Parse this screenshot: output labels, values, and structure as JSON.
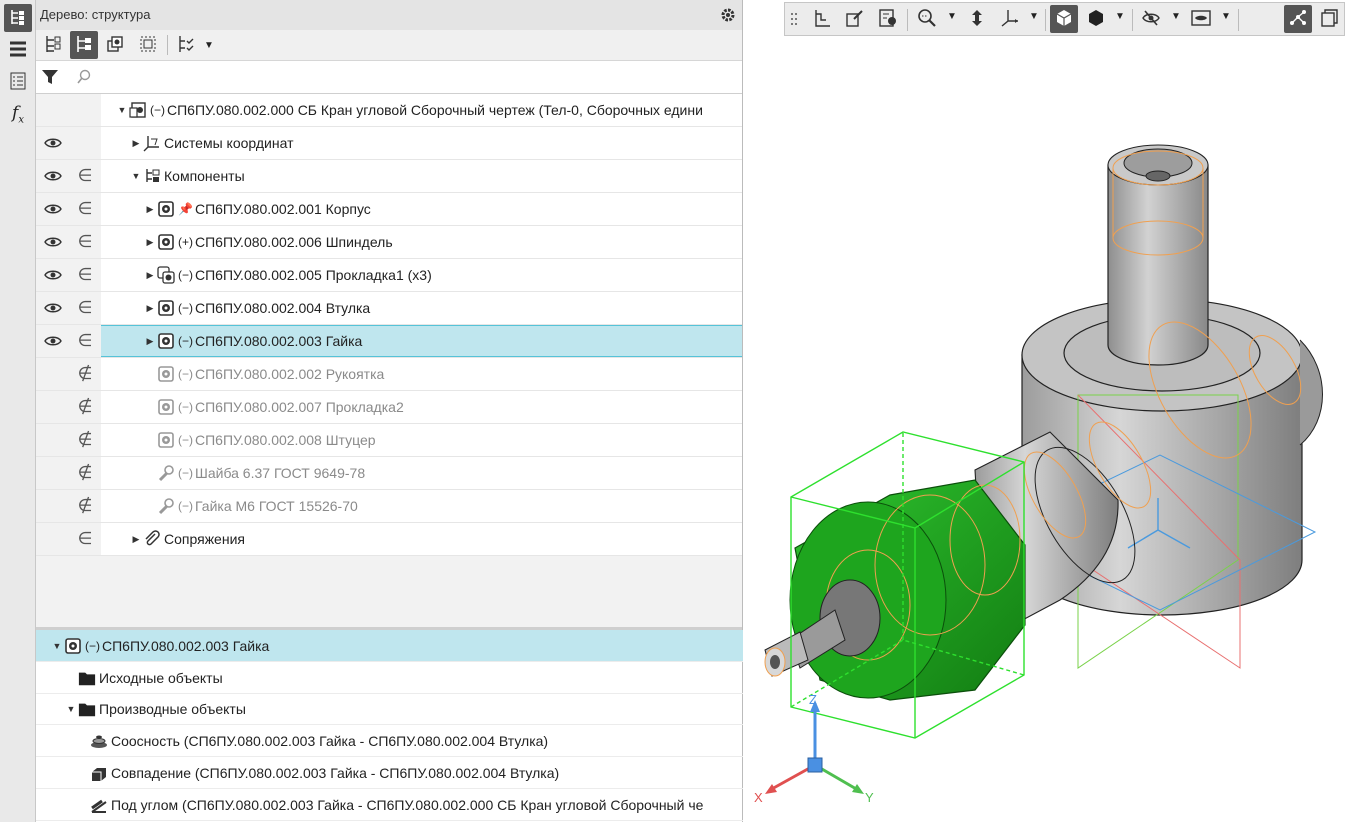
{
  "panel": {
    "title": "Дерево: структура",
    "search_placeholder": ""
  },
  "tree": {
    "root": {
      "label": "СП6ПУ.080.002.000 СБ Кран угловой Сборочный чертеж (Тел-0, Сборочных едини"
    },
    "items": [
      {
        "label": "Системы координат"
      },
      {
        "label": "Компоненты"
      },
      {
        "label": "СП6ПУ.080.002.001 Корпус"
      },
      {
        "label": "СП6ПУ.080.002.006 Шпиндель"
      },
      {
        "label": "СП6ПУ.080.002.005 Прокладка1 (х3)"
      },
      {
        "label": "СП6ПУ.080.002.004 Втулка"
      },
      {
        "label": "СП6ПУ.080.002.003 Гайка"
      },
      {
        "label": "СП6ПУ.080.002.002 Рукоятка"
      },
      {
        "label": "СП6ПУ.080.002.007 Прокладка2"
      },
      {
        "label": "СП6ПУ.080.002.008 Штуцер"
      },
      {
        "label": "Шайба 6.37 ГОСТ 9649-78"
      },
      {
        "label": "Гайка М6 ГОСТ 15526-70"
      },
      {
        "label": "Сопряжения"
      }
    ]
  },
  "details": {
    "header": "СП6ПУ.080.002.003 Гайка",
    "source_objects": "Исходные объекты",
    "derived_objects": "Производные объекты",
    "relations": [
      "Соосность (СП6ПУ.080.002.003 Гайка  -  СП6ПУ.080.002.004 Втулка)",
      "Совпадение (СП6ПУ.080.002.003 Гайка  -  СП6ПУ.080.002.004 Втулка)",
      "Под углом (СП6ПУ.080.002.003 Гайка  -  СП6ПУ.080.002.000 СБ Кран угловой Сборочный че"
    ]
  },
  "axes": {
    "x": "X",
    "y": "Y",
    "z": "Z"
  },
  "colors": {
    "selection": "#bfe6ee",
    "accent": "#55c3d8",
    "selected_part": "#1fb01f"
  }
}
